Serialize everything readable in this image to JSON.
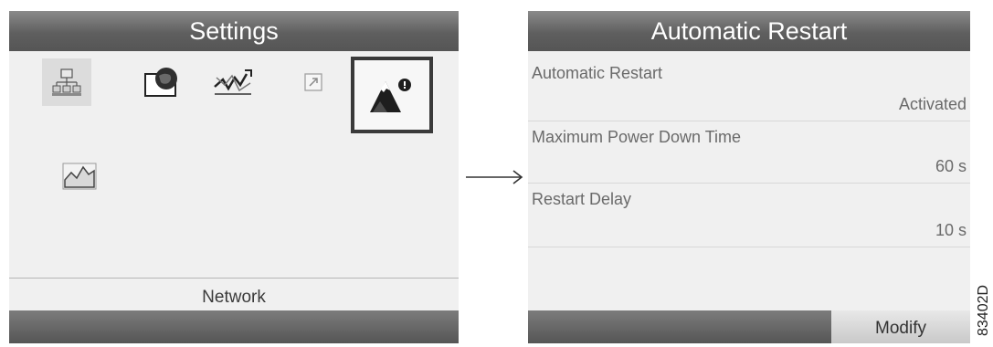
{
  "settings_screen": {
    "title": "Settings",
    "icons": [
      "network-icon",
      "folder-globe-icon",
      "trend-signal-icon",
      "external-link-icon",
      "mountain-alert-icon",
      "area-chart-icon"
    ],
    "selected_label": "Network"
  },
  "restart_screen": {
    "title": "Automatic Restart",
    "rows": [
      {
        "label": "Automatic Restart",
        "value": "Activated"
      },
      {
        "label": "Maximum Power Down Time",
        "value": "60 s"
      },
      {
        "label": "Restart Delay",
        "value": "10 s"
      }
    ],
    "modify_label": "Modify"
  },
  "figure_code": "83402D",
  "colors": {
    "title_bar": "#5f5f5f",
    "screen_bg": "#f0f0f0",
    "highlight_border": "#3a3a3a"
  }
}
